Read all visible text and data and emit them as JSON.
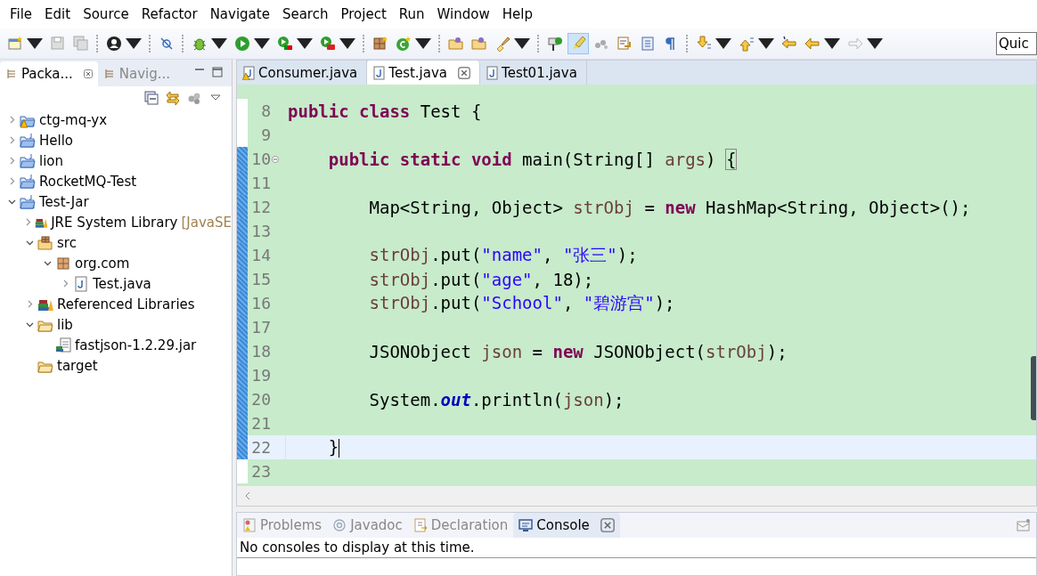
{
  "menu_bar": [
    "File",
    "Edit",
    "Source",
    "Refactor",
    "Navigate",
    "Search",
    "Project",
    "Run",
    "Window",
    "Help"
  ],
  "toolbar": {
    "buttons": [
      {
        "kind": "new",
        "dropdown": true,
        "selected": false
      },
      {
        "kind": "save",
        "dropdown": false,
        "selected": false
      },
      {
        "kind": "saveall",
        "dropdown": false,
        "selected": false
      },
      {
        "kind": "sep"
      },
      {
        "kind": "person",
        "dropdown": true,
        "selected": false
      },
      {
        "kind": "sep"
      },
      {
        "kind": "skip",
        "dropdown": false,
        "selected": false
      },
      {
        "kind": "sep"
      },
      {
        "kind": "bug",
        "dropdown": true,
        "selected": false
      },
      {
        "kind": "run",
        "dropdown": true,
        "selected": false
      },
      {
        "kind": "coverage",
        "dropdown": true,
        "selected": false
      },
      {
        "kind": "external",
        "dropdown": true,
        "selected": false
      },
      {
        "kind": "sep"
      },
      {
        "kind": "package",
        "dropdown": false,
        "selected": false
      },
      {
        "kind": "class",
        "dropdown": true,
        "selected": false
      },
      {
        "kind": "sep"
      },
      {
        "kind": "folder",
        "dropdown": false,
        "selected": false
      },
      {
        "kind": "folder",
        "dropdown": false,
        "selected": false
      },
      {
        "kind": "brush",
        "dropdown": true,
        "selected": false
      },
      {
        "kind": "sep"
      },
      {
        "kind": "pin",
        "dropdown": false,
        "selected": false
      },
      {
        "kind": "highlight",
        "dropdown": false,
        "selected": true
      },
      {
        "kind": "dots",
        "dropdown": false,
        "selected": false
      },
      {
        "kind": "doc",
        "dropdown": false,
        "selected": false
      },
      {
        "kind": "block",
        "dropdown": false,
        "selected": false
      },
      {
        "kind": "pilcrow",
        "dropdown": false,
        "selected": false
      },
      {
        "kind": "sep"
      },
      {
        "kind": "down",
        "dropdown": true,
        "selected": false
      },
      {
        "kind": "up",
        "dropdown": true,
        "selected": false
      },
      {
        "kind": "last",
        "dropdown": false,
        "selected": false
      },
      {
        "kind": "back",
        "dropdown": true,
        "selected": false
      },
      {
        "kind": "forward",
        "dropdown": true,
        "selected": false
      }
    ],
    "quick_access": "Quic"
  },
  "left_panel": {
    "tabs": [
      {
        "label": "Packa...",
        "selected": true
      },
      {
        "label": "Navig...",
        "selected": false
      }
    ],
    "tree": [
      {
        "label": "ctg-mq-yx",
        "kind": "project-warning",
        "expanded": false
      },
      {
        "label": "Hello",
        "kind": "project",
        "expanded": false
      },
      {
        "label": "lion",
        "kind": "project",
        "expanded": false
      },
      {
        "label": "RocketMQ-Test",
        "kind": "project",
        "expanded": false
      },
      {
        "label": "Test-Jar",
        "kind": "project",
        "expanded": true,
        "children": [
          {
            "label": "JRE System Library",
            "decoration": "[JavaSE",
            "kind": "library",
            "expanded": false
          },
          {
            "label": "src",
            "kind": "source",
            "expanded": true,
            "children": [
              {
                "label": "org.com",
                "kind": "package",
                "expanded": true,
                "children": [
                  {
                    "label": "Test.java",
                    "kind": "java",
                    "expanded": false
                  }
                ]
              }
            ]
          },
          {
            "label": "Referenced Libraries",
            "kind": "library",
            "expanded": false
          },
          {
            "label": "lib",
            "kind": "folder",
            "expanded": true,
            "children": [
              {
                "label": "fastjson-1.2.29.jar",
                "kind": "jar"
              }
            ]
          },
          {
            "label": "target",
            "kind": "folder"
          }
        ]
      }
    ]
  },
  "editor": {
    "tabs": [
      {
        "label": "Consumer.java",
        "warning": true,
        "selected": false
      },
      {
        "label": "Test.java",
        "warning": false,
        "selected": true
      },
      {
        "label": "Test01.java",
        "warning": false,
        "selected": false
      }
    ],
    "lines": [
      {
        "number": "8",
        "changed": false,
        "current": false,
        "tokens": [
          {
            "kind": "keyword",
            "text": "public class"
          },
          {
            "kind": "plain",
            "text": " Test {"
          }
        ]
      },
      {
        "number": "9",
        "changed": false,
        "current": false
      },
      {
        "number": "10",
        "changed": true,
        "current": false,
        "fold": true,
        "tokens": [
          {
            "kind": "keyword",
            "text": "    public static void"
          },
          {
            "kind": "plain",
            "text": " main(String[] "
          },
          {
            "kind": "variable",
            "text": "args"
          },
          {
            "kind": "plain",
            "text": ") "
          },
          {
            "kind": "match",
            "text": "{"
          }
        ]
      },
      {
        "number": "11",
        "changed": true,
        "current": false
      },
      {
        "number": "12",
        "changed": true,
        "current": false,
        "tokens": [
          {
            "kind": "plain",
            "text": "        Map<String, Object> "
          },
          {
            "kind": "variable",
            "text": "strObj"
          },
          {
            "kind": "plain",
            "text": " = "
          },
          {
            "kind": "keyword",
            "text": "new"
          },
          {
            "kind": "plain",
            "text": " HashMap<String, Object>();"
          }
        ]
      },
      {
        "number": "13",
        "changed": true,
        "current": false
      },
      {
        "number": "14",
        "changed": true,
        "current": false,
        "tokens": [
          {
            "kind": "variable",
            "text": "        strObj"
          },
          {
            "kind": "plain",
            "text": ".put("
          },
          {
            "kind": "string",
            "text": "\"name\""
          },
          {
            "kind": "plain",
            "text": ", "
          },
          {
            "kind": "string",
            "text": "\"张三\""
          },
          {
            "kind": "plain",
            "text": ");"
          }
        ]
      },
      {
        "number": "15",
        "changed": true,
        "current": false,
        "tokens": [
          {
            "kind": "variable",
            "text": "        strObj"
          },
          {
            "kind": "plain",
            "text": ".put("
          },
          {
            "kind": "string",
            "text": "\"age\""
          },
          {
            "kind": "plain",
            "text": ", 18);"
          }
        ]
      },
      {
        "number": "16",
        "changed": true,
        "current": false,
        "tokens": [
          {
            "kind": "variable",
            "text": "        strObj"
          },
          {
            "kind": "plain",
            "text": ".put("
          },
          {
            "kind": "string",
            "text": "\"School\""
          },
          {
            "kind": "plain",
            "text": ", "
          },
          {
            "kind": "string",
            "text": "\"碧游宫\""
          },
          {
            "kind": "plain",
            "text": ");"
          }
        ]
      },
      {
        "number": "17",
        "changed": true,
        "current": false
      },
      {
        "number": "18",
        "changed": true,
        "current": false,
        "tokens": [
          {
            "kind": "plain",
            "text": "        JSONObject "
          },
          {
            "kind": "variable",
            "text": "json"
          },
          {
            "kind": "plain",
            "text": " = "
          },
          {
            "kind": "keyword",
            "text": "new"
          },
          {
            "kind": "plain",
            "text": " JSONObject("
          },
          {
            "kind": "variable",
            "text": "strObj"
          },
          {
            "kind": "plain",
            "text": ");"
          }
        ]
      },
      {
        "number": "19",
        "changed": true,
        "current": false
      },
      {
        "number": "20",
        "changed": true,
        "current": false,
        "tokens": [
          {
            "kind": "plain",
            "text": "        System."
          },
          {
            "kind": "field",
            "text": "out"
          },
          {
            "kind": "plain",
            "text": ".println("
          },
          {
            "kind": "variable",
            "text": "json"
          },
          {
            "kind": "plain",
            "text": ");"
          }
        ]
      },
      {
        "number": "21",
        "changed": true,
        "current": false
      },
      {
        "number": "22",
        "changed": true,
        "current": true,
        "tokens": [
          {
            "kind": "plain",
            "text": "    }"
          }
        ]
      },
      {
        "number": "23",
        "changed": false,
        "current": false
      }
    ]
  },
  "bottom_panel": {
    "tabs": [
      {
        "label": "Problems",
        "kind": "problems",
        "selected": false
      },
      {
        "label": "Javadoc",
        "kind": "javadoc",
        "selected": false
      },
      {
        "label": "Declaration",
        "kind": "declaration",
        "selected": false
      },
      {
        "label": "Console",
        "kind": "console",
        "selected": true
      }
    ],
    "message": "No consoles to display at this time."
  }
}
